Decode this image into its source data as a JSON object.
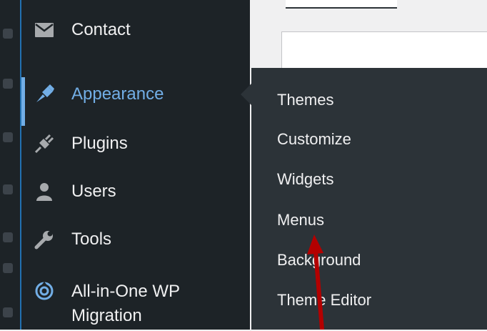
{
  "menu": {
    "items": [
      {
        "label": "Contact",
        "icon": "envelope-icon"
      },
      {
        "label": "Appearance",
        "icon": "paintbrush-icon",
        "current": true
      },
      {
        "label": "Plugins",
        "icon": "plugin-icon"
      },
      {
        "label": "Users",
        "icon": "user-icon"
      },
      {
        "label": "Tools",
        "icon": "wrench-icon"
      },
      {
        "label_line1": "All-in-One WP",
        "label_line2": "Migration",
        "icon": "migration-icon"
      }
    ]
  },
  "submenu": {
    "items": [
      {
        "label": "Themes"
      },
      {
        "label": "Customize"
      },
      {
        "label": "Widgets"
      },
      {
        "label": "Menus"
      },
      {
        "label": "Background"
      },
      {
        "label": "Theme Editor"
      }
    ]
  },
  "colors": {
    "menu_bg": "#1d2327",
    "submenu_bg": "#2c3338",
    "accent": "#72aee6",
    "text": "#f0f0f1",
    "annotation": "#b30000"
  }
}
